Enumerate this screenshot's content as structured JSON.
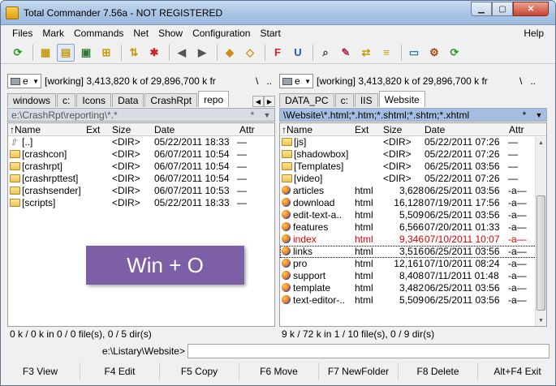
{
  "window": {
    "title": "Total Commander 7.56a - NOT REGISTERED",
    "minimize": "▁",
    "maximize": "▢",
    "close": "✕"
  },
  "menu": [
    "Files",
    "Mark",
    "Commands",
    "Net",
    "Show",
    "Configuration",
    "Start"
  ],
  "help": "Help",
  "toolbar": [
    {
      "icon": "refresh-icon",
      "glyph": "⟳",
      "color": "#2a9a2a"
    },
    {
      "icon": "brief-view-icon",
      "glyph": "▦",
      "color": "#c79a10"
    },
    {
      "icon": "full-view-icon",
      "glyph": "▤",
      "color": "#c79a10",
      "active": true
    },
    {
      "icon": "thumbnails-icon",
      "glyph": "▣",
      "color": "#2f7a2f"
    },
    {
      "icon": "tree-icon",
      "glyph": "⊞",
      "color": "#c79a10"
    },
    {
      "icon": "invert-selection-icon",
      "glyph": "⇅",
      "color": "#c79a10"
    },
    {
      "icon": "clear-selection-icon",
      "glyph": "✱",
      "color": "#cc2222"
    },
    {
      "icon": "back-icon",
      "glyph": "◀",
      "color": "#555555"
    },
    {
      "icon": "forward-icon",
      "glyph": "▶",
      "color": "#555555"
    },
    {
      "icon": "pack-icon",
      "glyph": "◆",
      "color": "#d28a10"
    },
    {
      "icon": "unpack-icon",
      "glyph": "◇",
      "color": "#d28a10"
    },
    {
      "icon": "ftp-icon",
      "glyph": "F",
      "color": "#cc2222"
    },
    {
      "icon": "url-icon",
      "glyph": "U",
      "color": "#2255cc"
    },
    {
      "icon": "search-icon",
      "glyph": "⌕",
      "color": "#333333"
    },
    {
      "icon": "rename-icon",
      "glyph": "✎",
      "color": "#aa3355"
    },
    {
      "icon": "sync-icon",
      "glyph": "⇄",
      "color": "#c79a10"
    },
    {
      "icon": "compare-icon",
      "glyph": "≡",
      "color": "#c79a10"
    },
    {
      "icon": "notepad-icon",
      "glyph": "▭",
      "color": "#2a7fbf"
    },
    {
      "icon": "settings-icon",
      "glyph": "⚙",
      "color": "#aa4411"
    },
    {
      "icon": "reload-icon",
      "glyph": "⟳",
      "color": "#2a9a2a"
    }
  ],
  "left": {
    "drive": "e",
    "drive_info": "[working]  3,413,820 k of 29,896,700 k fr",
    "nav_root": "\\",
    "nav_up": "..",
    "tabs": [
      "windows",
      "c:",
      "Icons",
      "Data",
      "CrashRpt",
      "repo"
    ],
    "selected_tab": 5,
    "path": "e:\\CrashRpt\\reporting\\*.*",
    "path_star": "*",
    "path_down": "▼",
    "columns": {
      "name": "↑Name",
      "ext": "Ext",
      "size": "Size",
      "date": "Date",
      "attr": "Attr"
    },
    "rows": [
      {
        "name": "[..]",
        "ext": "",
        "size": "<DIR>",
        "date": "05/22/2011 18:33",
        "attr": "—",
        "kind": "up"
      },
      {
        "name": "[crashcon]",
        "ext": "",
        "size": "<DIR>",
        "date": "06/07/2011 10:54",
        "attr": "—",
        "kind": "dir"
      },
      {
        "name": "[crashrpt]",
        "ext": "",
        "size": "<DIR>",
        "date": "06/07/2011 10:54",
        "attr": "—",
        "kind": "dir"
      },
      {
        "name": "[crashrpttest]",
        "ext": "",
        "size": "<DIR>",
        "date": "06/07/2011 10:54",
        "attr": "—",
        "kind": "dir"
      },
      {
        "name": "[crashsender]",
        "ext": "",
        "size": "<DIR>",
        "date": "06/07/2011 10:53",
        "attr": "—",
        "kind": "dir"
      },
      {
        "name": "[scripts]",
        "ext": "",
        "size": "<DIR>",
        "date": "05/22/2011 18:33",
        "attr": "—",
        "kind": "dir"
      }
    ],
    "status": "0 k / 0 k in 0 / 0 file(s), 0 / 5 dir(s)"
  },
  "right": {
    "drive": "e",
    "drive_info": "[working]  3,413,820 k of 29,896,700 k fr",
    "nav_root": "\\",
    "nav_up": "..",
    "tabs": [
      "DATA_PC",
      "c:",
      "IIS",
      "Website"
    ],
    "selected_tab": 3,
    "path": "\\Website\\*.html;*.htm;*.shtml;*.shtm;*.xhtml",
    "path_star": "*",
    "path_down": "▼",
    "columns": {
      "name": "↑Name",
      "ext": "Ext",
      "size": "Size",
      "date": "Date",
      "attr": "Attr"
    },
    "rows": [
      {
        "name": "[js]",
        "ext": "",
        "size": "<DIR>",
        "date": "05/22/2011 07:26",
        "attr": "—",
        "kind": "dir"
      },
      {
        "name": "[shadowbox]",
        "ext": "",
        "size": "<DIR>",
        "date": "05/22/2011 07:26",
        "attr": "—",
        "kind": "dir"
      },
      {
        "name": "[Templates]",
        "ext": "",
        "size": "<DIR>",
        "date": "06/25/2011 03:56",
        "attr": "—",
        "kind": "dir"
      },
      {
        "name": "[video]",
        "ext": "",
        "size": "<DIR>",
        "date": "05/22/2011 07:26",
        "attr": "—",
        "kind": "dir"
      },
      {
        "name": "articles",
        "ext": "html",
        "size": "3,628",
        "date": "06/25/2011 03:56",
        "attr": "-a—",
        "kind": "file"
      },
      {
        "name": "download",
        "ext": "html",
        "size": "16,128",
        "date": "07/19/2011 17:56",
        "attr": "-a—",
        "kind": "file"
      },
      {
        "name": "edit-text-a..",
        "ext": "html",
        "size": "5,509",
        "date": "06/25/2011 03:56",
        "attr": "-a—",
        "kind": "file"
      },
      {
        "name": "features",
        "ext": "html",
        "size": "6,566",
        "date": "07/20/2011 01:33",
        "attr": "-a—",
        "kind": "file"
      },
      {
        "name": "index",
        "ext": "html",
        "size": "9,346",
        "date": "07/10/2011 10:07",
        "attr": "-a—",
        "kind": "file",
        "red": true
      },
      {
        "name": "links",
        "ext": "html",
        "size": "3,516",
        "date": "06/25/2011 03:56",
        "attr": "-a—",
        "kind": "file",
        "cursor": true
      },
      {
        "name": "pro",
        "ext": "html",
        "size": "12,161",
        "date": "07/10/2011 08:24",
        "attr": "-a—",
        "kind": "file"
      },
      {
        "name": "support",
        "ext": "html",
        "size": "8,408",
        "date": "07/11/2011 01:48",
        "attr": "-a—",
        "kind": "file"
      },
      {
        "name": "template",
        "ext": "html",
        "size": "3,482",
        "date": "06/25/2011 03:56",
        "attr": "-a—",
        "kind": "file"
      },
      {
        "name": "text-editor-..",
        "ext": "html",
        "size": "5,509",
        "date": "06/25/2011 03:56",
        "attr": "-a—",
        "kind": "file"
      }
    ],
    "status": "9 k / 72 k in 1 / 10 file(s), 0 / 9 dir(s)"
  },
  "cmdline": {
    "path": "e:\\Listary\\Website>",
    "value": ""
  },
  "fkeys": [
    "F3 View",
    "F4 Edit",
    "F5 Copy",
    "F6 Move",
    "F7 NewFolder",
    "F8 Delete",
    "Alt+F4 Exit"
  ],
  "overlay": "Win + O",
  "colors": {
    "accent_path": "#a4bde0",
    "overlay": "#7d5fa6",
    "highlight": "#e00000"
  }
}
